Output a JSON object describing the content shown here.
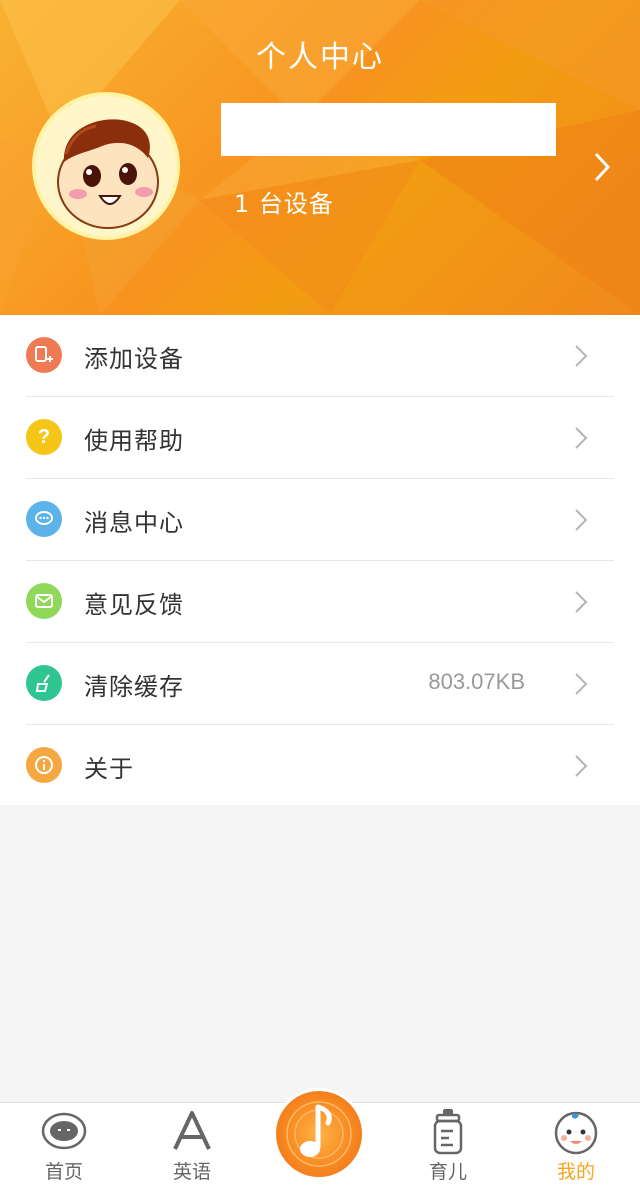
{
  "header": {
    "title": "个人中心",
    "device_count": "1 台设备"
  },
  "menu": {
    "items": [
      {
        "label": "添加设备",
        "icon": "add-device-icon",
        "color": "#ef7b54",
        "value": ""
      },
      {
        "label": "使用帮助",
        "icon": "help-icon",
        "color": "#f5c518",
        "value": ""
      },
      {
        "label": "消息中心",
        "icon": "message-icon",
        "color": "#5bb3ea",
        "value": ""
      },
      {
        "label": "意见反馈",
        "icon": "feedback-icon",
        "color": "#8fd85a",
        "value": ""
      },
      {
        "label": "清除缓存",
        "icon": "clear-cache-icon",
        "color": "#2ec590",
        "value": "803.07KB"
      },
      {
        "label": "关于",
        "icon": "about-icon",
        "color": "#f5a742",
        "value": ""
      }
    ]
  },
  "tabbar": {
    "tabs": [
      {
        "label": "首页",
        "icon": "robot-icon"
      },
      {
        "label": "英语",
        "icon": "letter-a-icon"
      },
      {
        "label": "育儿",
        "icon": "baby-bottle-icon"
      },
      {
        "label": "我的",
        "icon": "baby-face-icon",
        "active": true
      }
    ],
    "center_icon": "music-note-icon"
  },
  "colors": {
    "accent": "#f5a623",
    "header_orange": "#f7931e"
  }
}
